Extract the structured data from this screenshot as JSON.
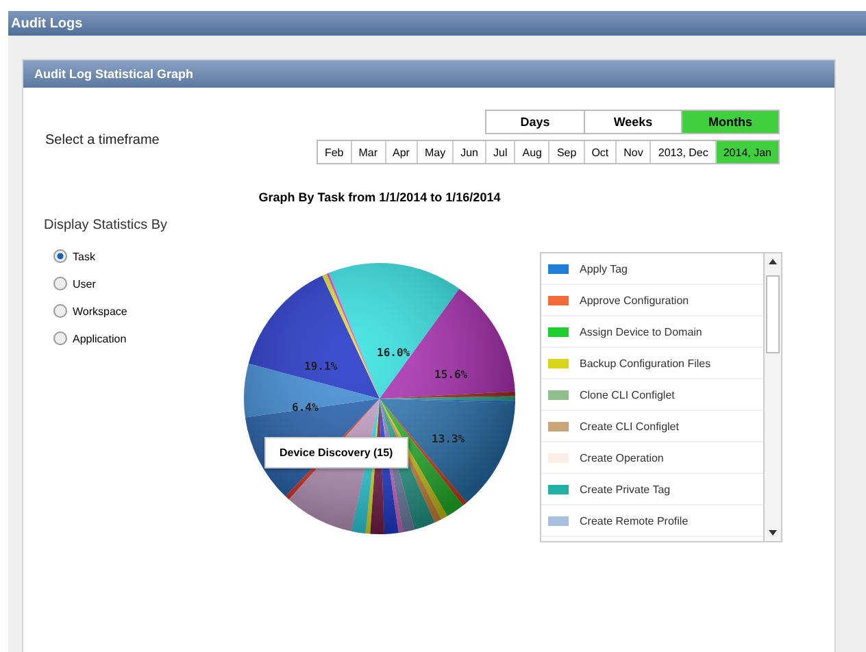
{
  "page_title": "Audit Logs",
  "panel_title": "Audit Log Statistical Graph",
  "timeframe_label": "Select a timeframe",
  "granularity": [
    {
      "label": "Days",
      "selected": false
    },
    {
      "label": "Weeks",
      "selected": false
    },
    {
      "label": "Months",
      "selected": true
    }
  ],
  "months": [
    {
      "label": "Feb",
      "selected": false
    },
    {
      "label": "Mar",
      "selected": false
    },
    {
      "label": "Apr",
      "selected": false
    },
    {
      "label": "May",
      "selected": false
    },
    {
      "label": "Jun",
      "selected": false
    },
    {
      "label": "Jul",
      "selected": false
    },
    {
      "label": "Aug",
      "selected": false
    },
    {
      "label": "Sep",
      "selected": false
    },
    {
      "label": "Oct",
      "selected": false
    },
    {
      "label": "Nov",
      "selected": false
    },
    {
      "label": "2013, Dec",
      "selected": false
    },
    {
      "label": "2014, Jan",
      "selected": true
    }
  ],
  "chart_title": "Graph By Task from 1/1/2014 to 1/16/2014",
  "display_by": {
    "label": "Display Statistics By",
    "options": [
      {
        "label": "Task",
        "selected": true
      },
      {
        "label": "User",
        "selected": false
      },
      {
        "label": "Workspace",
        "selected": false
      },
      {
        "label": "Application",
        "selected": false
      }
    ]
  },
  "pie_labels": [
    "16.0%",
    "15.6%",
    "19.1%",
    "13.3%",
    "6.4%"
  ],
  "tooltip": "Device Discovery (15)",
  "legend": [
    {
      "label": "Apply Tag",
      "color": "#1f7fd6"
    },
    {
      "label": "Approve Configuration",
      "color": "#f26a3a"
    },
    {
      "label": "Assign Device to Domain",
      "color": "#22cc33"
    },
    {
      "label": "Backup Configuration Files",
      "color": "#d8d61a"
    },
    {
      "label": "Clone CLI Configlet",
      "color": "#8fbf8a"
    },
    {
      "label": "Create CLI Configlet",
      "color": "#c9a57c"
    },
    {
      "label": "Create Operation",
      "color": "#fbeee4"
    },
    {
      "label": "Create Private Tag",
      "color": "#22b0a6"
    },
    {
      "label": "Create Remote Profile",
      "color": "#a9bfdf"
    }
  ]
}
